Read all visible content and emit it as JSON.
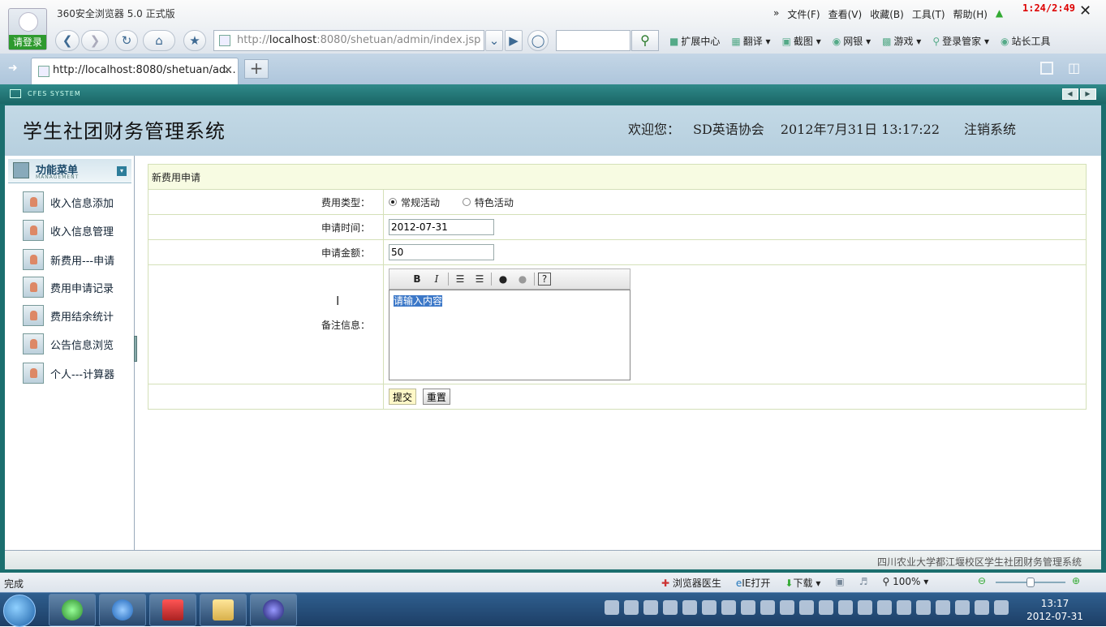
{
  "browser": {
    "name": "360安全浏览器 5.0 正式版",
    "login_label": "请登录",
    "menu": [
      "文件(F)",
      "查看(V)",
      "收藏(B)",
      "工具(T)",
      "帮助(H)"
    ],
    "timer": "1:24/2:49",
    "url_prefix": "http://",
    "url_host": "localhost",
    "url_rest": ":8080/shetuan/admin/index.jsp",
    "tools": [
      "扩展中心",
      "翻译",
      "截图",
      "网银",
      "游戏",
      "登录管家",
      "站长工具"
    ],
    "tab_title": "http://localhost:8080/shetuan/ad...",
    "frame_caption": "CFES SYSTEM",
    "status": "完成",
    "status_tools": [
      "浏览器医生",
      "IE打开",
      "下载"
    ],
    "zoom": "100%"
  },
  "page": {
    "title": "学生社团财务管理系统",
    "welcome_label": "欢迎您：",
    "user": "SD英语协会",
    "datetime": "2012年7月31日  13:17:22",
    "logout": "注销系统",
    "menu_title": "功能菜单",
    "menu_subtitle": "MANAGEMENT",
    "menu_items": [
      "收入信息添加",
      "收入信息管理",
      "新费用---申请",
      "费用申请记录",
      "费用结余统计",
      "公告信息浏览",
      "个人---计算器"
    ],
    "footer": "四川农业大学都江堰校区学生社团财务管理系统"
  },
  "form": {
    "heading": "新费用申请",
    "type_label": "费用类型：",
    "type_options": [
      "常规活动",
      "特色活动"
    ],
    "type_selected": "常规活动",
    "date_label": "申请时间：",
    "date_value": "2012-07-31",
    "amount_label": "申请金额：",
    "amount_value": "50",
    "note_label": "备注信息：",
    "note_placeholder": "请输入内容",
    "submit": "提交",
    "reset": "重置"
  },
  "taskbar": {
    "time": "13:17",
    "date": "2012-07-31"
  }
}
